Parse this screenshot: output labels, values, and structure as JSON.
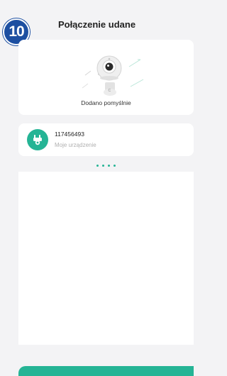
{
  "step": {
    "number": "10"
  },
  "header": {
    "title": "Połączenie udane"
  },
  "success": {
    "message": "Dodano pomyślnie",
    "illustration_icon": "camera-icon"
  },
  "device": {
    "id": "117456493",
    "name": "Moje urządzenie",
    "icon": "camera-icon"
  },
  "pager": {
    "count": 4
  },
  "colors": {
    "accent": "#25b495",
    "badge": "#1d4fa1",
    "background": "#f3f3f5",
    "card": "#ffffff"
  }
}
